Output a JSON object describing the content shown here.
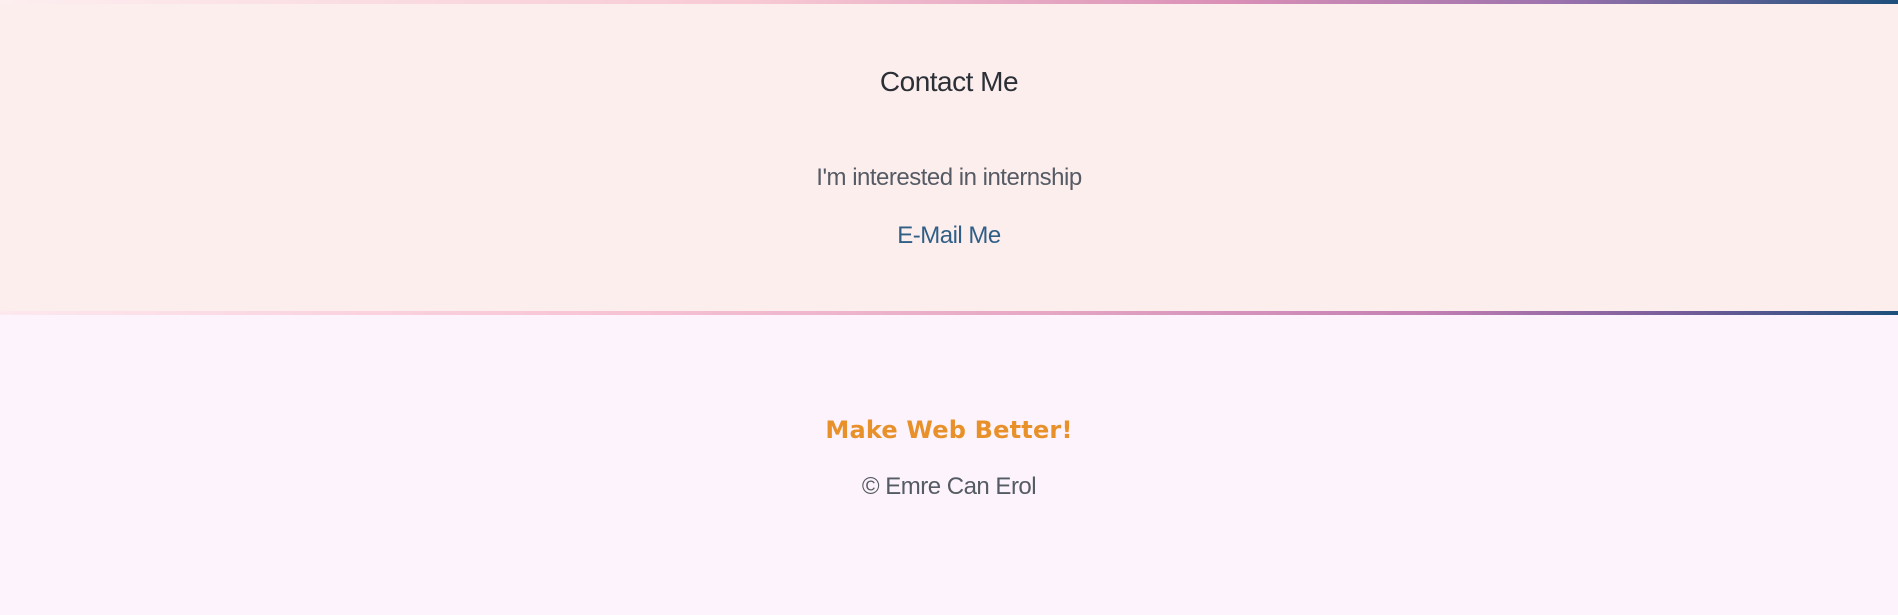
{
  "contact": {
    "title": "Contact Me",
    "text": "I'm interested in internship",
    "link_label": "E-Mail Me"
  },
  "footer": {
    "slogan": "Make Web Better!",
    "copyright": "© Emre Can Erol"
  },
  "colors": {
    "contact_background": "#fdeeee",
    "footer_background": "#fdf3fc",
    "link": "#2f5f86",
    "slogan": "#e8912a",
    "gradient_end": "#1d4f7c"
  }
}
